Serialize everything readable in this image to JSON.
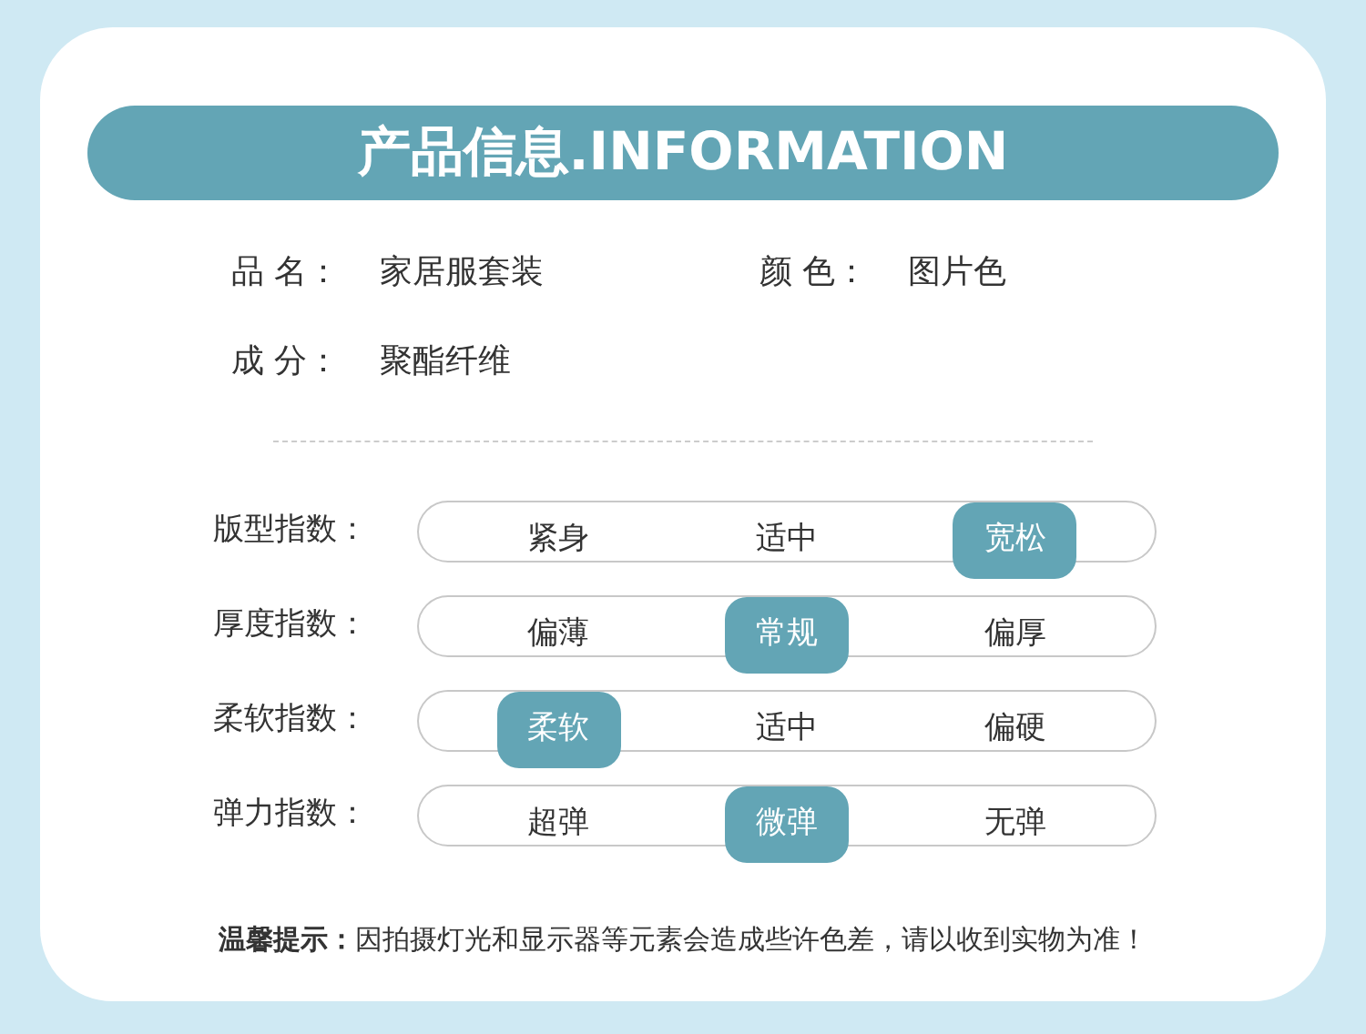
{
  "header": {
    "title": "产品信息.INFORMATION"
  },
  "product_info": [
    {
      "label": "品 名：",
      "value": "家居服套装"
    },
    {
      "label": "颜 色：",
      "value": "图片色"
    },
    {
      "label": "成 分：",
      "value": "聚酯纤维"
    }
  ],
  "indices": [
    {
      "label": "版型指数：",
      "options": [
        {
          "label": "紧身",
          "selected": false
        },
        {
          "label": "适中",
          "selected": false
        },
        {
          "label": "宽松",
          "selected": true
        }
      ]
    },
    {
      "label": "厚度指数：",
      "options": [
        {
          "label": "偏薄",
          "selected": false
        },
        {
          "label": "常规",
          "selected": true
        },
        {
          "label": "偏厚",
          "selected": false
        }
      ]
    },
    {
      "label": "柔软指数：",
      "options": [
        {
          "label": "柔软",
          "selected": true
        },
        {
          "label": "适中",
          "selected": false
        },
        {
          "label": "偏硬",
          "selected": false
        }
      ]
    },
    {
      "label": "弹力指数：",
      "options": [
        {
          "label": "超弹",
          "selected": false
        },
        {
          "label": "微弹",
          "selected": true
        },
        {
          "label": "无弹",
          "selected": false
        }
      ]
    }
  ],
  "notice": {
    "title": "温馨提示：",
    "text": "因拍摄灯光和显示器等元素会造成些许色差，请以收到实物为准！"
  }
}
